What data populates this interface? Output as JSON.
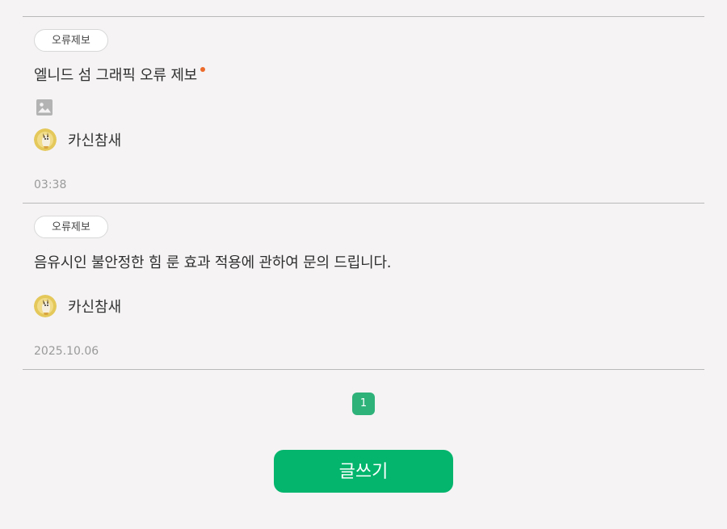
{
  "posts": [
    {
      "tag": "오류제보",
      "title": "엘니드 섬 그래픽 오류 제보",
      "is_new": true,
      "has_image": true,
      "author": "카신참새",
      "date": "03:38"
    },
    {
      "tag": "오류제보",
      "title": "음유시인 불안정한 힘 룬 효과 적용에 관하여 문의 드립니다.",
      "is_new": false,
      "has_image": false,
      "author": "카신참새",
      "date": "2025.10.06"
    }
  ],
  "pagination": {
    "current_page": "1"
  },
  "write_button_label": "글쓰기",
  "colors": {
    "accent_green": "#03b56d",
    "page_active": "#2eb27a",
    "new_dot": "#ec6a2a",
    "background": "#f5f3f4"
  }
}
